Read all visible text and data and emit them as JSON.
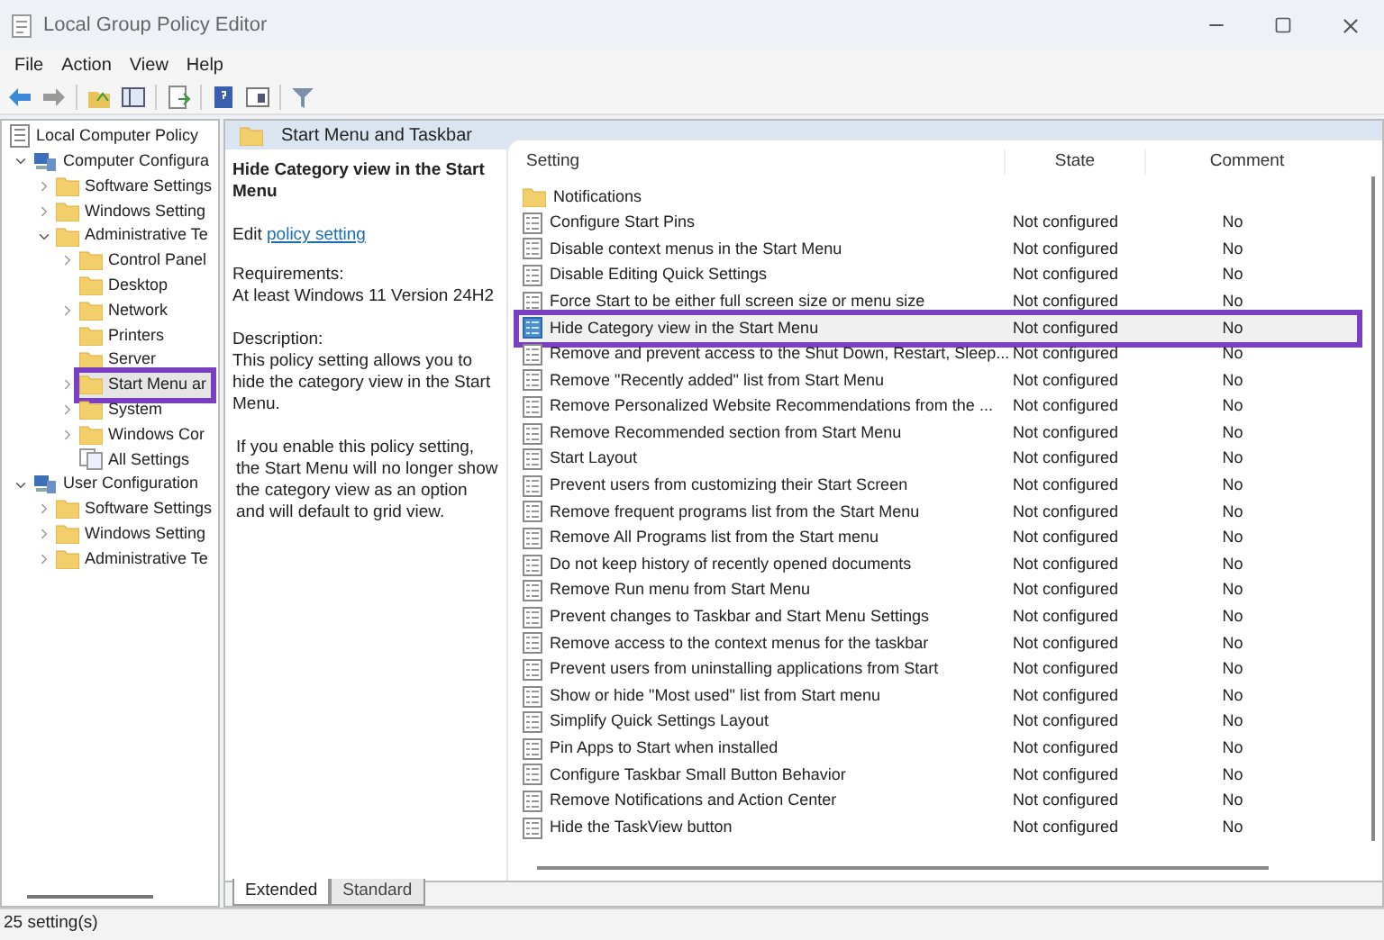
{
  "window": {
    "title": "Local Group Policy Editor"
  },
  "menu": [
    "File",
    "Action",
    "View",
    "Help"
  ],
  "tree": [
    {
      "label": "Local Computer Policy",
      "kind": "policy",
      "highlighted": false,
      "children": [
        {
          "label": "Computer Configura",
          "kind": "computer",
          "expanded": true,
          "highlighted": false,
          "children": [
            {
              "label": "Software Settings",
              "kind": "folder",
              "expanded": false,
              "highlighted": false
            },
            {
              "label": "Windows Setting",
              "kind": "folder",
              "expanded": false,
              "highlighted": false
            },
            {
              "label": "Administrative Te",
              "kind": "folder",
              "expanded": true,
              "highlighted": false,
              "children": [
                {
                  "label": "Control Panel",
                  "kind": "folder",
                  "expanded": false,
                  "highlighted": false
                },
                {
                  "label": "Desktop",
                  "kind": "folder",
                  "highlighted": false
                },
                {
                  "label": "Network",
                  "kind": "folder",
                  "expanded": false,
                  "highlighted": false
                },
                {
                  "label": "Printers",
                  "kind": "folder",
                  "highlighted": false
                },
                {
                  "label": "Server",
                  "kind": "folder",
                  "highlighted": false
                },
                {
                  "label": "Start Menu ar",
                  "kind": "folder",
                  "expanded": false,
                  "highlighted": true
                },
                {
                  "label": "System",
                  "kind": "folder",
                  "expanded": false,
                  "highlighted": false
                },
                {
                  "label": "Windows Cor",
                  "kind": "folder",
                  "expanded": false,
                  "highlighted": false
                },
                {
                  "label": "All Settings",
                  "kind": "settings",
                  "highlighted": false
                }
              ]
            }
          ]
        },
        {
          "label": "User Configuration",
          "kind": "computer",
          "expanded": true,
          "highlighted": false,
          "children": [
            {
              "label": "Software Settings",
              "kind": "folder",
              "expanded": false,
              "highlighted": false
            },
            {
              "label": "Windows Setting",
              "kind": "folder",
              "expanded": false,
              "highlighted": false
            },
            {
              "label": "Administrative Te",
              "kind": "folder",
              "expanded": false,
              "highlighted": false
            }
          ]
        }
      ]
    }
  ],
  "section_title": "Start Menu and Taskbar",
  "details": {
    "title": "Hide Category view in the Start Menu",
    "edit_prefix": "Edit",
    "edit_link": "policy setting",
    "requirements_label": "Requirements:",
    "requirements": "At least Windows 11 Version 24H2",
    "description_label": "Description:",
    "paragraphs": [
      "This policy setting allows you to hide the category view in the Start Menu.",
      "If you enable this policy setting, the Start Menu will no longer show the category view as an option and will default to grid view."
    ]
  },
  "table": {
    "columns": [
      "Setting",
      "State",
      "Comment"
    ],
    "rows": [
      {
        "kind": "folder",
        "name": "Notifications",
        "selected": false,
        "highlighted": false
      },
      {
        "kind": "policy",
        "name": "Configure Start Pins",
        "state": "Not configured",
        "comment": "No",
        "selected": false,
        "highlighted": false
      },
      {
        "kind": "policy",
        "name": "Disable context menus in the Start Menu",
        "state": "Not configured",
        "comment": "No",
        "selected": false,
        "highlighted": false
      },
      {
        "kind": "policy",
        "name": "Disable Editing Quick Settings",
        "state": "Not configured",
        "comment": "No",
        "selected": false,
        "highlighted": false
      },
      {
        "kind": "policy",
        "name": "Force Start to be either full screen size or menu size",
        "state": "Not configured",
        "comment": "No",
        "selected": false,
        "highlighted": false
      },
      {
        "kind": "policy",
        "name": "Hide Category view in the Start Menu",
        "state": "Not configured",
        "comment": "No",
        "selected": true,
        "highlighted": true
      },
      {
        "kind": "policy",
        "name": "Remove and prevent access to the Shut Down, Restart, Sleep...",
        "state": "Not configured",
        "comment": "No",
        "selected": false,
        "highlighted": false
      },
      {
        "kind": "policy",
        "name": "Remove \"Recently added\" list from Start Menu",
        "state": "Not configured",
        "comment": "No",
        "selected": false,
        "highlighted": false
      },
      {
        "kind": "policy",
        "name": "Remove Personalized Website Recommendations from the ...",
        "state": "Not configured",
        "comment": "No",
        "selected": false,
        "highlighted": false
      },
      {
        "kind": "policy",
        "name": "Remove Recommended section from Start Menu",
        "state": "Not configured",
        "comment": "No",
        "selected": false,
        "highlighted": false
      },
      {
        "kind": "policy",
        "name": "Start Layout",
        "state": "Not configured",
        "comment": "No",
        "selected": false,
        "highlighted": false
      },
      {
        "kind": "policy",
        "name": "Prevent users from customizing their Start Screen",
        "state": "Not configured",
        "comment": "No",
        "selected": false,
        "highlighted": false
      },
      {
        "kind": "policy",
        "name": "Remove frequent programs list from the Start Menu",
        "state": "Not configured",
        "comment": "No",
        "selected": false,
        "highlighted": false
      },
      {
        "kind": "policy",
        "name": "Remove All Programs list from the Start menu",
        "state": "Not configured",
        "comment": "No",
        "selected": false,
        "highlighted": false
      },
      {
        "kind": "policy",
        "name": "Do not keep history of recently opened documents",
        "state": "Not configured",
        "comment": "No",
        "selected": false,
        "highlighted": false
      },
      {
        "kind": "policy",
        "name": "Remove Run menu from Start Menu",
        "state": "Not configured",
        "comment": "No",
        "selected": false,
        "highlighted": false
      },
      {
        "kind": "policy",
        "name": "Prevent changes to Taskbar and Start Menu Settings",
        "state": "Not configured",
        "comment": "No",
        "selected": false,
        "highlighted": false
      },
      {
        "kind": "policy",
        "name": "Remove access to the context menus for the taskbar",
        "state": "Not configured",
        "comment": "No",
        "selected": false,
        "highlighted": false
      },
      {
        "kind": "policy",
        "name": "Prevent users from uninstalling applications from Start",
        "state": "Not configured",
        "comment": "No",
        "selected": false,
        "highlighted": false
      },
      {
        "kind": "policy",
        "name": "Show or hide \"Most used\" list from Start menu",
        "state": "Not configured",
        "comment": "No",
        "selected": false,
        "highlighted": false
      },
      {
        "kind": "policy",
        "name": "Simplify Quick Settings Layout",
        "state": "Not configured",
        "comment": "No",
        "selected": false,
        "highlighted": false
      },
      {
        "kind": "policy",
        "name": "Pin Apps to Start when installed",
        "state": "Not configured",
        "comment": "No",
        "selected": false,
        "highlighted": false
      },
      {
        "kind": "policy",
        "name": "Configure Taskbar Small Button Behavior",
        "state": "Not configured",
        "comment": "No",
        "selected": false,
        "highlighted": false
      },
      {
        "kind": "policy",
        "name": "Remove Notifications and Action Center",
        "state": "Not configured",
        "comment": "No",
        "selected": false,
        "highlighted": false
      },
      {
        "kind": "policy",
        "name": "Hide the TaskView button",
        "state": "Not configured",
        "comment": "No",
        "selected": false,
        "highlighted": false
      }
    ]
  },
  "tabs": [
    {
      "label": "Extended",
      "selected": true
    },
    {
      "label": "Standard",
      "selected": false
    }
  ],
  "status_bar": "25 setting(s)"
}
